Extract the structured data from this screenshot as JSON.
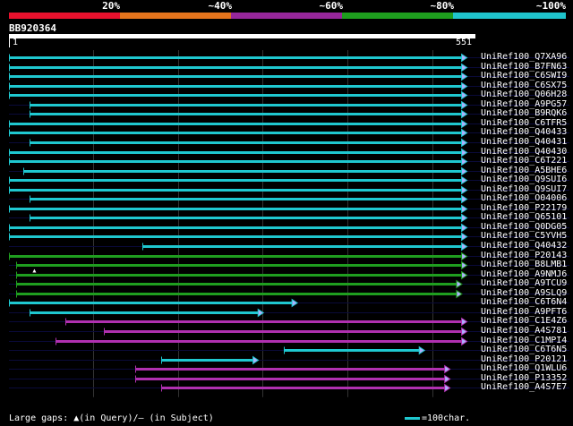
{
  "scale": {
    "labels": [
      "20%",
      "~40%",
      "~60%",
      "~80%",
      "~100%"
    ],
    "colors": [
      "#e8112d",
      "#e4741c",
      "#97279b",
      "#1e9e1e",
      "#1fc4cc"
    ]
  },
  "query": {
    "name": "BB920364",
    "start": "1",
    "end": "551",
    "length": 551
  },
  "hits": [
    {
      "label": "UniRef100_Q7XA96",
      "start": 1,
      "end": 540,
      "color": "cyan",
      "arrow": true,
      "small": []
    },
    {
      "label": "UniRef100_B7FN63",
      "start": 1,
      "end": 540,
      "color": "cyan",
      "arrow": true,
      "small": []
    },
    {
      "label": "UniRef100_C6SWI9",
      "start": 1,
      "end": 540,
      "color": "cyan",
      "arrow": true,
      "small": [
        [
          3,
          9
        ]
      ]
    },
    {
      "label": "UniRef100_C6SX75",
      "start": 1,
      "end": 540,
      "color": "cyan",
      "arrow": true,
      "small": [
        [
          3,
          9
        ]
      ]
    },
    {
      "label": "UniRef100_Q06H28",
      "start": 1,
      "end": 540,
      "color": "cyan",
      "arrow": true,
      "small": [
        [
          3,
          9
        ]
      ]
    },
    {
      "label": "UniRef100_A9PG57",
      "start": 25,
      "end": 540,
      "color": "cyan",
      "arrow": true,
      "small": []
    },
    {
      "label": "UniRef100_B9RQK6",
      "start": 25,
      "end": 540,
      "color": "cyan",
      "arrow": true,
      "small": []
    },
    {
      "label": "UniRef100_C6TFR5",
      "start": 1,
      "end": 540,
      "color": "cyan",
      "arrow": true,
      "small": [
        [
          3,
          16
        ]
      ]
    },
    {
      "label": "UniRef100_Q40433",
      "start": 1,
      "end": 540,
      "color": "cyan",
      "arrow": true,
      "small": [
        [
          3,
          16
        ]
      ]
    },
    {
      "label": "UniRef100_Q40431",
      "start": 25,
      "end": 540,
      "color": "cyan",
      "arrow": true,
      "small": []
    },
    {
      "label": "UniRef100_Q40430",
      "start": 1,
      "end": 540,
      "color": "cyan",
      "arrow": true,
      "small": [
        [
          3,
          9
        ]
      ]
    },
    {
      "label": "UniRef100_C6T221",
      "start": 1,
      "end": 540,
      "color": "cyan",
      "arrow": true,
      "small": [
        [
          3,
          20
        ]
      ]
    },
    {
      "label": "UniRef100_A5BHE6",
      "start": 18,
      "end": 540,
      "color": "cyan",
      "arrow": true,
      "small": []
    },
    {
      "label": "UniRef100_Q9SUI6",
      "start": 1,
      "end": 540,
      "color": "cyan",
      "arrow": true,
      "small": [
        [
          3,
          9
        ]
      ]
    },
    {
      "label": "UniRef100_Q9SUI7",
      "start": 1,
      "end": 540,
      "color": "cyan",
      "arrow": true,
      "small": [
        [
          3,
          9
        ]
      ]
    },
    {
      "label": "UniRef100_O04006",
      "start": 25,
      "end": 540,
      "color": "cyan",
      "arrow": true,
      "small": []
    },
    {
      "label": "UniRef100_P22179",
      "start": 1,
      "end": 540,
      "color": "cyan",
      "arrow": true,
      "small": [
        [
          3,
          20
        ]
      ]
    },
    {
      "label": "UniRef100_Q65101",
      "start": 25,
      "end": 540,
      "color": "cyan",
      "arrow": true,
      "small": [
        [
          33,
          63
        ]
      ]
    },
    {
      "label": "UniRef100_Q0DG05",
      "start": 1,
      "end": 540,
      "color": "cyan",
      "arrow": true,
      "small": [
        [
          3,
          9
        ]
      ]
    },
    {
      "label": "UniRef100_C5YVH5",
      "start": 1,
      "end": 540,
      "color": "cyan",
      "arrow": true,
      "small": []
    },
    {
      "label": "UniRef100_Q40432",
      "start": 158,
      "end": 540,
      "color": "cyan",
      "arrow": true,
      "small": []
    },
    {
      "label": "UniRef100_P20143",
      "start": 1,
      "end": 540,
      "color": "green",
      "arrow": true,
      "small": [
        [
          3,
          9
        ]
      ]
    },
    {
      "label": "UniRef100_B8LMB1",
      "start": 9,
      "end": 540,
      "color": "green",
      "arrow": true,
      "small": []
    },
    {
      "label": "UniRef100_A9NMJ6",
      "start": 9,
      "end": 540,
      "color": "green",
      "arrow": true,
      "small": [],
      "gap_query": 31
    },
    {
      "label": "UniRef100_A9TCU9",
      "start": 9,
      "end": 534,
      "color": "green",
      "arrow": true,
      "small": []
    },
    {
      "label": "UniRef100_A9SLQ9",
      "start": 9,
      "end": 534,
      "color": "green",
      "arrow": true,
      "small": [
        [
          15,
          44
        ]
      ]
    },
    {
      "label": "UniRef100_C6T6N4",
      "start": 1,
      "end": 340,
      "color": "cyan",
      "arrow": true,
      "small": [
        [
          3,
          9
        ]
      ]
    },
    {
      "label": "UniRef100_A9PFT6",
      "start": 25,
      "end": 300,
      "color": "cyan",
      "arrow": true,
      "small": []
    },
    {
      "label": "UniRef100_C1E4Z6",
      "start": 68,
      "end": 540,
      "color": "magenta",
      "arrow": true,
      "small": []
    },
    {
      "label": "UniRef100_A4S781",
      "start": 113,
      "end": 540,
      "color": "magenta",
      "arrow": true,
      "small": []
    },
    {
      "label": "UniRef100_C1MPI4",
      "start": 56,
      "end": 540,
      "color": "magenta",
      "arrow": true,
      "small": [
        [
          56,
          86
        ]
      ]
    },
    {
      "label": "UniRef100_C6T6N5",
      "start": 325,
      "end": 490,
      "color": "cyan",
      "arrow": true,
      "small": []
    },
    {
      "label": "UniRef100_P20121",
      "start": 180,
      "end": 294,
      "color": "cyan",
      "arrow": true,
      "small": []
    },
    {
      "label": "UniRef100_Q1WLU6",
      "start": 150,
      "end": 520,
      "color": "magenta",
      "arrow": true,
      "small": []
    },
    {
      "label": "UniRef100_P13352",
      "start": 150,
      "end": 520,
      "color": "magenta",
      "arrow": true,
      "small": []
    },
    {
      "label": "UniRef100_A4S7E7",
      "start": 180,
      "end": 520,
      "color": "magenta",
      "arrow": true,
      "small": []
    }
  ],
  "colors": {
    "cyan": "#1fc8d0",
    "green": "#1f9e1f",
    "magenta": "#b030b0",
    "track": "#0a0a3a",
    "grid": "#333333",
    "arrow_fill": "#b0b0ff"
  },
  "legend": {
    "gaps_text": "Large gaps: ▲(in Query)/– (in Subject)",
    "scale_text": "=100char."
  }
}
